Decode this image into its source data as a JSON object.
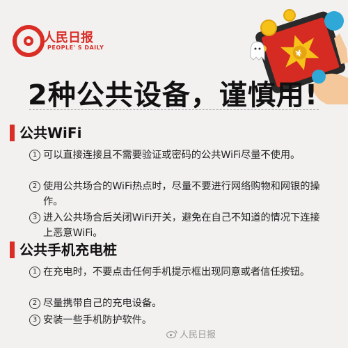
{
  "logo": {
    "name": "人民日报",
    "english": "PEOPLE' S DAILY"
  },
  "title": "2种公共设备，谨慎用!",
  "sections": [
    {
      "header": "公共WiFi",
      "items": [
        {
          "num": "1",
          "text": "可以直接连接且不需要验证或密码的公共WiFi尽量不使用。"
        },
        {
          "num": "2",
          "text": "使用公共场合的WiFi热点时，尽量不要进行网络购物和网银的操作。"
        },
        {
          "num": "3",
          "text": "进入公共场合后关闭WiFi开关，避免在自己不知道的情况下连接上恶意WiFi。"
        }
      ]
    },
    {
      "header": "公共手机充电桩",
      "items": [
        {
          "num": "1",
          "text": "在充电时，不要点击任何手机提示框出现同意或者信任按钮。"
        },
        {
          "num": "2",
          "text": "尽量携带自己的充电设备。"
        },
        {
          "num": "3",
          "text": "安装一些手机防护软件。"
        }
      ]
    }
  ],
  "watermark": "人民日报",
  "colors": {
    "accent": "#d92d25",
    "background": "#f2f1f0"
  },
  "icons": [
    "people-daily-logo-icon",
    "tablet-phone-illustration-icon",
    "weibo-icon"
  ]
}
